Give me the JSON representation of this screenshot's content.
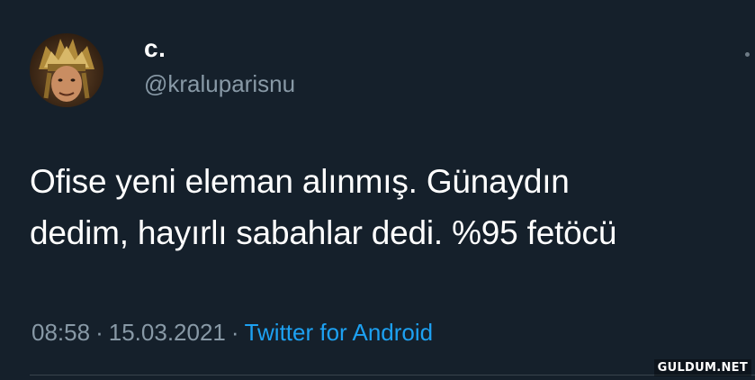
{
  "tweet": {
    "display_name": "c.",
    "handle": "@kraluparisnu",
    "text_lines": [
      "Ofise yeni eleman alınmış. Günaydın",
      "dedim, hayırlı sabahlar dedi. %95 fetöcü"
    ],
    "time": "08:58",
    "date": "15.03.2021",
    "separator": "·",
    "source": "Twitter for Android"
  },
  "watermark": "GULDUM.NET",
  "colors": {
    "background": "#15202b",
    "secondary_text": "#8899a6",
    "accent": "#1da1f2",
    "divider": "#38444d"
  },
  "icons": {
    "avatar": "profile-avatar",
    "more": "more-options-icon"
  }
}
